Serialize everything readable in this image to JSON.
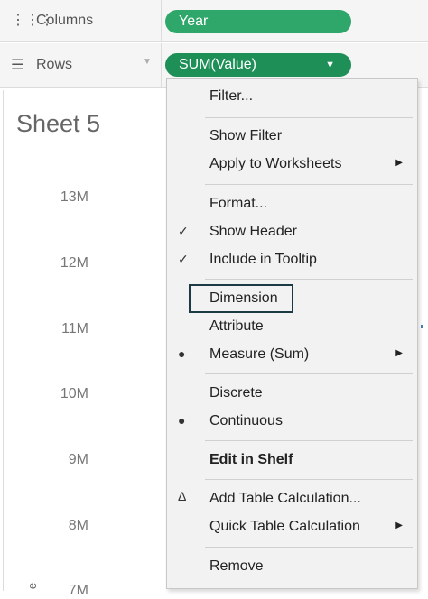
{
  "shelves": {
    "columns": {
      "icon": "columns-icon",
      "label": "Columns",
      "pill": "Year"
    },
    "rows": {
      "icon": "rows-icon",
      "label": "Rows",
      "pill": "SUM(Value)"
    }
  },
  "sheet": {
    "title": "Sheet 5",
    "y_ticks": [
      "13M",
      "12M",
      "11M",
      "10M",
      "9M",
      "8M",
      "7M"
    ],
    "axis_title_partial": "e"
  },
  "context_menu": {
    "items": [
      {
        "label": "Filter..."
      },
      {
        "label": "Show Filter"
      },
      {
        "label": "Apply to Worksheets",
        "submenu": true
      },
      {
        "label": "Format..."
      },
      {
        "label": "Show Header",
        "checked": true
      },
      {
        "label": "Include in Tooltip",
        "checked": true
      },
      {
        "label": "Dimension"
      },
      {
        "label": "Attribute"
      },
      {
        "label": "Measure (Sum)",
        "bullet": true,
        "submenu": true
      },
      {
        "label": "Discrete"
      },
      {
        "label": "Continuous",
        "bullet": true
      },
      {
        "label": "Edit in Shelf",
        "bold": true
      },
      {
        "label": "Add Table Calculation...",
        "icon": "delta-icon"
      },
      {
        "label": "Quick Table Calculation",
        "submenu": true
      },
      {
        "label": "Remove"
      }
    ]
  },
  "colors": {
    "pill": "#2fa66a",
    "pill_active": "#1f8f58",
    "highlight": "#1c3a44"
  }
}
